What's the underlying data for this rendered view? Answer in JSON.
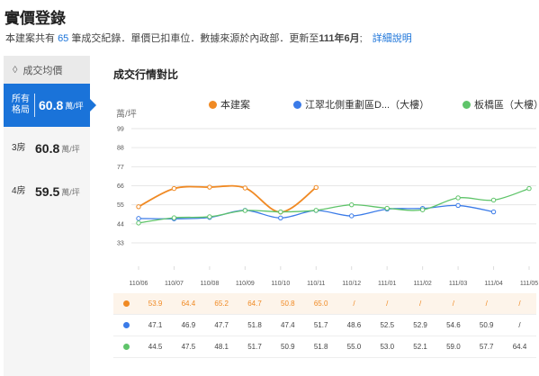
{
  "page": {
    "title": "實價登錄",
    "summary": {
      "prefix": "本建案共有",
      "count": "65",
      "mid": "筆成交紀錄．單價已扣車位．數據來源於內政部．更新至",
      "updated": "111年6月",
      "suffix": ";",
      "link": "詳細說明"
    }
  },
  "sidebar": {
    "header": "成交均價",
    "header_icon": "tag-icon",
    "items": [
      {
        "label": "所有格局",
        "value": "60.8",
        "unit": "萬/坪",
        "active": true
      },
      {
        "label": "3房",
        "value": "60.8",
        "unit": "萬/坪",
        "active": false
      },
      {
        "label": "4房",
        "value": "59.5",
        "unit": "萬/坪",
        "active": false
      }
    ]
  },
  "chart": {
    "title": "成交行情對比",
    "y_unit": "萬/坪",
    "legend": [
      "本建案",
      "江翠北側重劃區D...（大樓）",
      "板橋區（大樓）"
    ]
  },
  "chart_data": {
    "type": "line",
    "categories": [
      "110/06",
      "110/07",
      "110/08",
      "110/09",
      "110/10",
      "110/11",
      "110/12",
      "111/01",
      "111/02",
      "111/03",
      "111/04",
      "111/05"
    ],
    "ylim": [
      33,
      99
    ],
    "yticks": [
      33,
      44,
      55,
      66,
      77,
      88,
      99
    ],
    "grid": true,
    "series": [
      {
        "name": "本建案",
        "color": "#f08a24",
        "values": [
          53.9,
          64.4,
          65.2,
          64.7,
          50.8,
          65.0,
          null,
          null,
          null,
          null,
          null,
          null
        ]
      },
      {
        "name": "江翠北側重劃區D...（大樓）",
        "color": "#3b7be8",
        "values": [
          47.1,
          46.9,
          47.7,
          51.8,
          47.4,
          51.7,
          48.6,
          52.5,
          52.9,
          54.6,
          50.9,
          null
        ]
      },
      {
        "name": "板橋區（大樓）",
        "color": "#5fc46a",
        "values": [
          44.5,
          47.5,
          48.1,
          51.7,
          50.9,
          51.8,
          55.0,
          53.0,
          52.1,
          59.0,
          57.7,
          64.4
        ]
      }
    ]
  },
  "table": {
    "rows": [
      {
        "color": "#f08a24",
        "cells": [
          "53.9",
          "64.4",
          "65.2",
          "64.7",
          "50.8",
          "65.0",
          "/",
          "/",
          "/",
          "/",
          "/",
          "/"
        ]
      },
      {
        "color": "#3b7be8",
        "cells": [
          "47.1",
          "46.9",
          "47.7",
          "51.8",
          "47.4",
          "51.7",
          "48.6",
          "52.5",
          "52.9",
          "54.6",
          "50.9",
          "/"
        ]
      },
      {
        "color": "#5fc46a",
        "cells": [
          "44.5",
          "47.5",
          "48.1",
          "51.7",
          "50.9",
          "51.8",
          "55.0",
          "53.0",
          "52.1",
          "59.0",
          "57.7",
          "64.4"
        ]
      }
    ]
  }
}
